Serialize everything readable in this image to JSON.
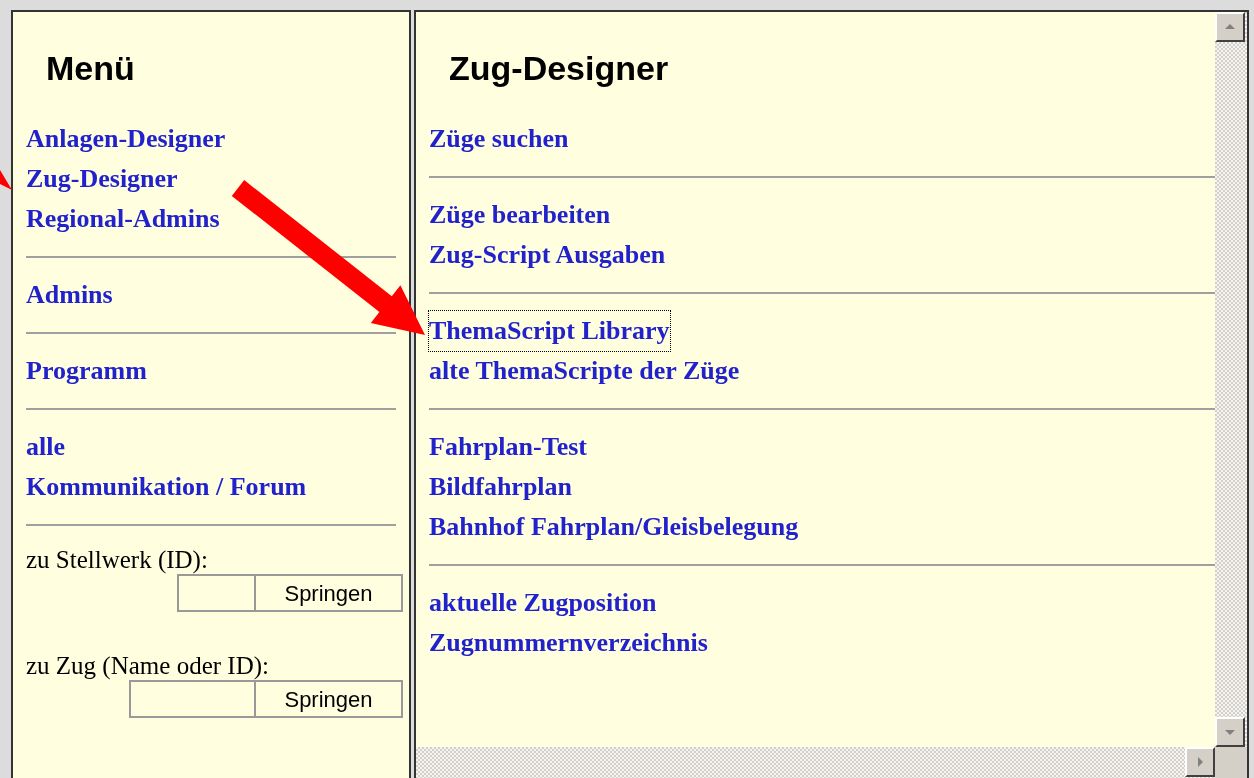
{
  "menu": {
    "title": "Menü",
    "groups": [
      {
        "links": [
          {
            "label": "Anlagen-Designer"
          },
          {
            "label": "Zug-Designer"
          },
          {
            "label": "Regional-Admins"
          }
        ]
      },
      {
        "links": [
          {
            "label": "Admins"
          }
        ]
      },
      {
        "links": [
          {
            "label": "Programm"
          }
        ]
      },
      {
        "links": [
          {
            "label": "alle"
          },
          {
            "label": "Kommunikation / Forum"
          }
        ]
      }
    ],
    "jumps": [
      {
        "label": "zu Stellwerk (ID):",
        "button": "Springen"
      },
      {
        "label": "zu Zug (Name oder ID):",
        "button": "Springen"
      }
    ]
  },
  "content": {
    "title": "Zug-Designer",
    "groups": [
      {
        "links": [
          {
            "label": "Züge suchen",
            "focused": false
          }
        ]
      },
      {
        "links": [
          {
            "label": "Züge bearbeiten",
            "focused": false
          },
          {
            "label": "Zug-Script Ausgaben",
            "focused": false
          }
        ]
      },
      {
        "links": [
          {
            "label": "ThemaScript Library",
            "focused": true
          },
          {
            "label": "alte ThemaScripte der Züge",
            "focused": false
          }
        ]
      },
      {
        "links": [
          {
            "label": "Fahrplan-Test",
            "focused": false
          },
          {
            "label": "Bildfahrplan",
            "focused": false
          },
          {
            "label": "Bahnhof Fahrplan/Gleisbelegung",
            "focused": false
          }
        ]
      },
      {
        "links": [
          {
            "label": "aktuelle Zugposition",
            "focused": false
          },
          {
            "label": "Zugnummernverzeichnis",
            "focused": false
          }
        ]
      }
    ]
  }
}
